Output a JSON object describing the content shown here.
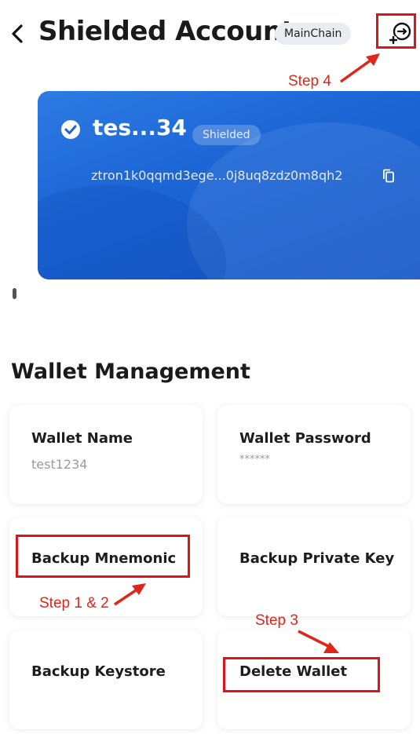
{
  "header": {
    "title": "Shielded Account",
    "chain_badge": "MainChain"
  },
  "account_card": {
    "name": "tes...34",
    "badge": "Shielded",
    "address": "ztron1k0qqmd3ege...0j8uq8zdz0m8qh2"
  },
  "section": {
    "title": "Wallet Management"
  },
  "tiles": {
    "wallet_name": {
      "label": "Wallet Name",
      "value": "test1234"
    },
    "wallet_password": {
      "label": "Wallet Password",
      "value": "******"
    },
    "backup_mnemonic": {
      "label": "Backup Mnemonic"
    },
    "backup_private_key": {
      "label": "Backup Private Key"
    },
    "backup_keystore": {
      "label": "Backup Keystore"
    },
    "delete_wallet": {
      "label": "Delete Wallet"
    }
  },
  "annotations": {
    "step4": "Step 4",
    "step12": "Step 1 & 2",
    "step3": "Step 3"
  },
  "colors": {
    "annotation_red": "#d9161c",
    "card_blue": "#1c66d6"
  }
}
